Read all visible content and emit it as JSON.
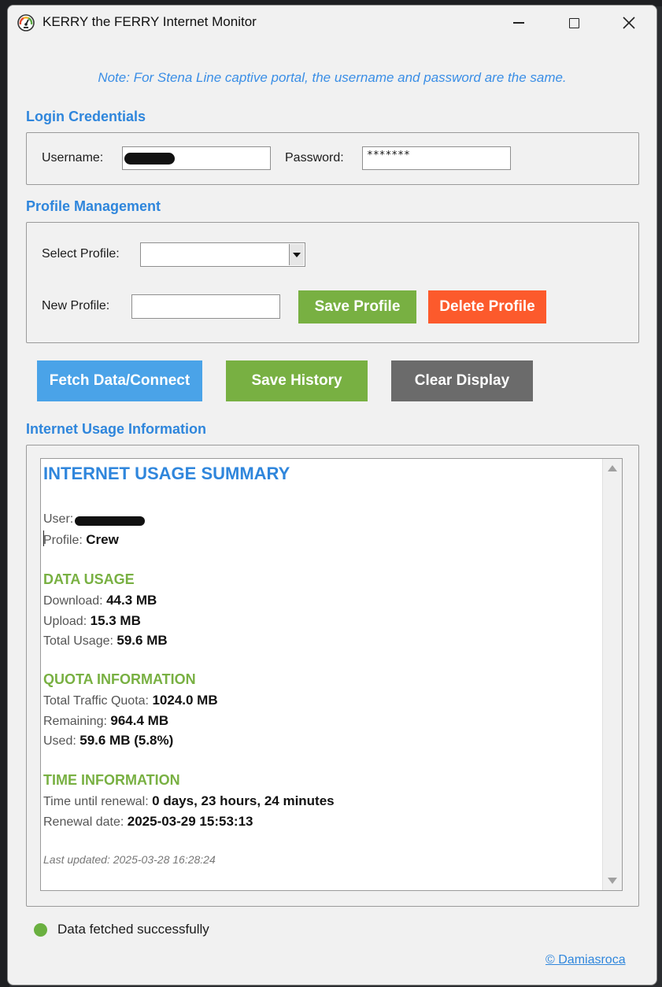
{
  "window": {
    "title": "KERRY the FERRY Internet Monitor",
    "icon": "speedometer-icon"
  },
  "note": "Note: For Stena Line captive portal, the username and password are the same.",
  "login": {
    "section_title": "Login Credentials",
    "username_label": "Username:",
    "username_value": "",
    "password_label": "Password:",
    "password_value": "*******"
  },
  "profile": {
    "section_title": "Profile Management",
    "select_label": "Select Profile:",
    "select_value": "",
    "new_label": "New Profile:",
    "new_value": "",
    "save_button": "Save Profile",
    "delete_button": "Delete Profile"
  },
  "actions": {
    "fetch_button": "Fetch Data/Connect",
    "save_history_button": "Save History",
    "clear_button": "Clear Display"
  },
  "usage": {
    "section_title": "Internet Usage Information",
    "summary_title": "INTERNET USAGE SUMMARY",
    "user_label": "User:",
    "profile_label": "Profile:",
    "profile_value": "Crew",
    "data_title": "DATA USAGE",
    "download_label": "Download:",
    "download_value": "44.3 MB",
    "upload_label": "Upload:",
    "upload_value": "15.3 MB",
    "total_label": "Total Usage:",
    "total_value": "59.6 MB",
    "quota_title": "QUOTA INFORMATION",
    "quota_label": "Total Traffic Quota:",
    "quota_value": "1024.0 MB",
    "remaining_label": "Remaining:",
    "remaining_value": "964.4 MB",
    "used_label": "Used:",
    "used_value": "59.6 MB (5.8%)",
    "time_title": "TIME INFORMATION",
    "renewal_in_label": "Time until renewal:",
    "renewal_in_value": "0 days, 23 hours, 24 minutes",
    "renewal_date_label": "Renewal date:",
    "renewal_date_value": "2025-03-29 15:53:13",
    "last_updated": "Last updated: 2025-03-28 16:28:24"
  },
  "status": {
    "text": "Data fetched successfully",
    "color": "#6ab040"
  },
  "credit": "© Damiasroca",
  "colors": {
    "accent_blue": "#2f86dc",
    "green": "#78b042",
    "red": "#fc5a2c",
    "blue_button": "#4aa3e8",
    "gray_button": "#6b6b6b"
  }
}
